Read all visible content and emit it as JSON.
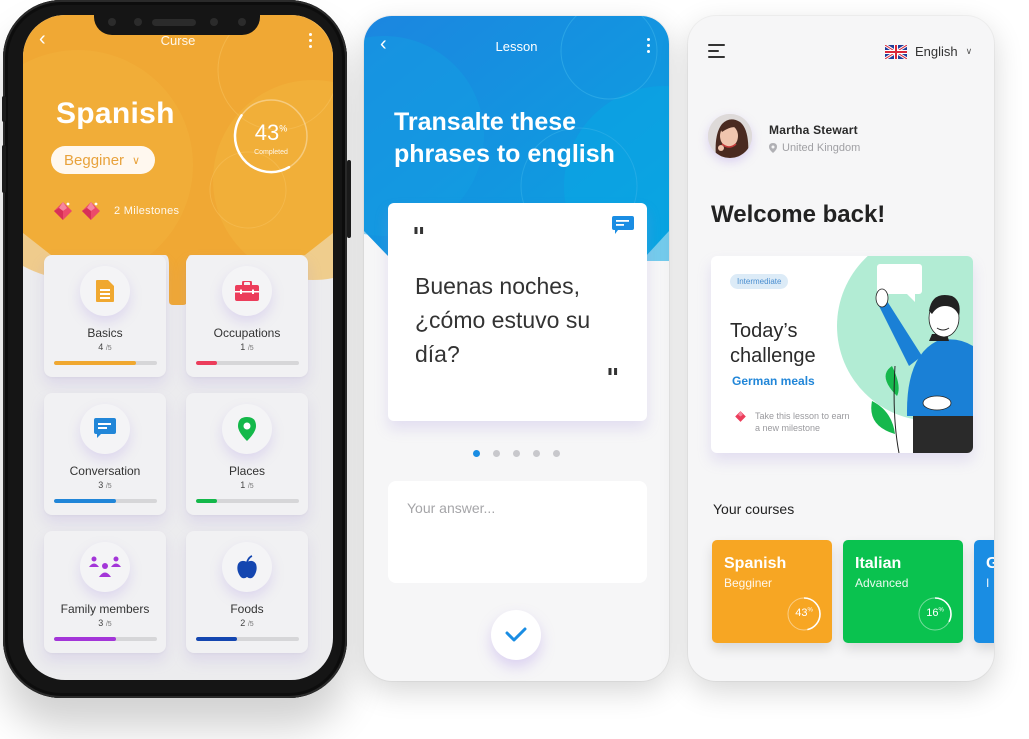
{
  "course_screen": {
    "title": "Curse",
    "language": "Spanish",
    "level": "Begginer",
    "progress": {
      "value": 43,
      "unit": "%",
      "caption": "Completed"
    },
    "milestones": {
      "count": 2,
      "label": "2 Milestones"
    },
    "colors": {
      "header": "#f0a834"
    },
    "topics": [
      {
        "name": "Basics",
        "done": 4,
        "total": 5,
        "icon": "document-icon",
        "color": "#f0a830"
      },
      {
        "name": "Occupations",
        "done": 1,
        "total": 5,
        "icon": "briefcase-icon",
        "color": "#ec3d5b"
      },
      {
        "name": "Conversation",
        "done": 3,
        "total": 5,
        "icon": "chat-icon",
        "color": "#2186d8"
      },
      {
        "name": "Places",
        "done": 1,
        "total": 5,
        "icon": "location-pin-icon",
        "color": "#14b84a"
      },
      {
        "name": "Family members",
        "done": 3,
        "total": 5,
        "icon": "family-icon",
        "color": "#a335d8"
      },
      {
        "name": "Foods",
        "done": 2,
        "total": 5,
        "icon": "apple-icon",
        "color": "#1446b0"
      }
    ]
  },
  "lesson_screen": {
    "title": "Lesson",
    "heading": "Transalte these phrases to english",
    "phrase": "Buenas noches, ¿cómo estuvo su día?",
    "quote_open": "\"",
    "quote_close": "\"",
    "pagination": {
      "total": 5,
      "current": 1
    },
    "answer_placeholder": "Your answer...",
    "colors": {
      "header": "#1a8ee0",
      "accent": "#1a8de3"
    }
  },
  "home_screen": {
    "language_selector": {
      "flag": "uk-flag-icon",
      "label": "English"
    },
    "user": {
      "name": "Martha Stewart",
      "location": "United Kingdom"
    },
    "welcome": "Welcome back!",
    "challenge": {
      "badge": "Intermediate",
      "title": "Today’s challenge",
      "topic": "German meals",
      "reward_text": "Take this lesson to earn a new milestone"
    },
    "courses_title": "Your courses",
    "courses": [
      {
        "name": "Spanish",
        "level": "Begginer",
        "progress": 43,
        "color": "#f7a623"
      },
      {
        "name": "Italian",
        "level": "Advanced",
        "progress": 16,
        "color": "#0ac24f"
      },
      {
        "name": "G",
        "level": "I",
        "progress": null,
        "color": "#1a8de3"
      }
    ]
  }
}
